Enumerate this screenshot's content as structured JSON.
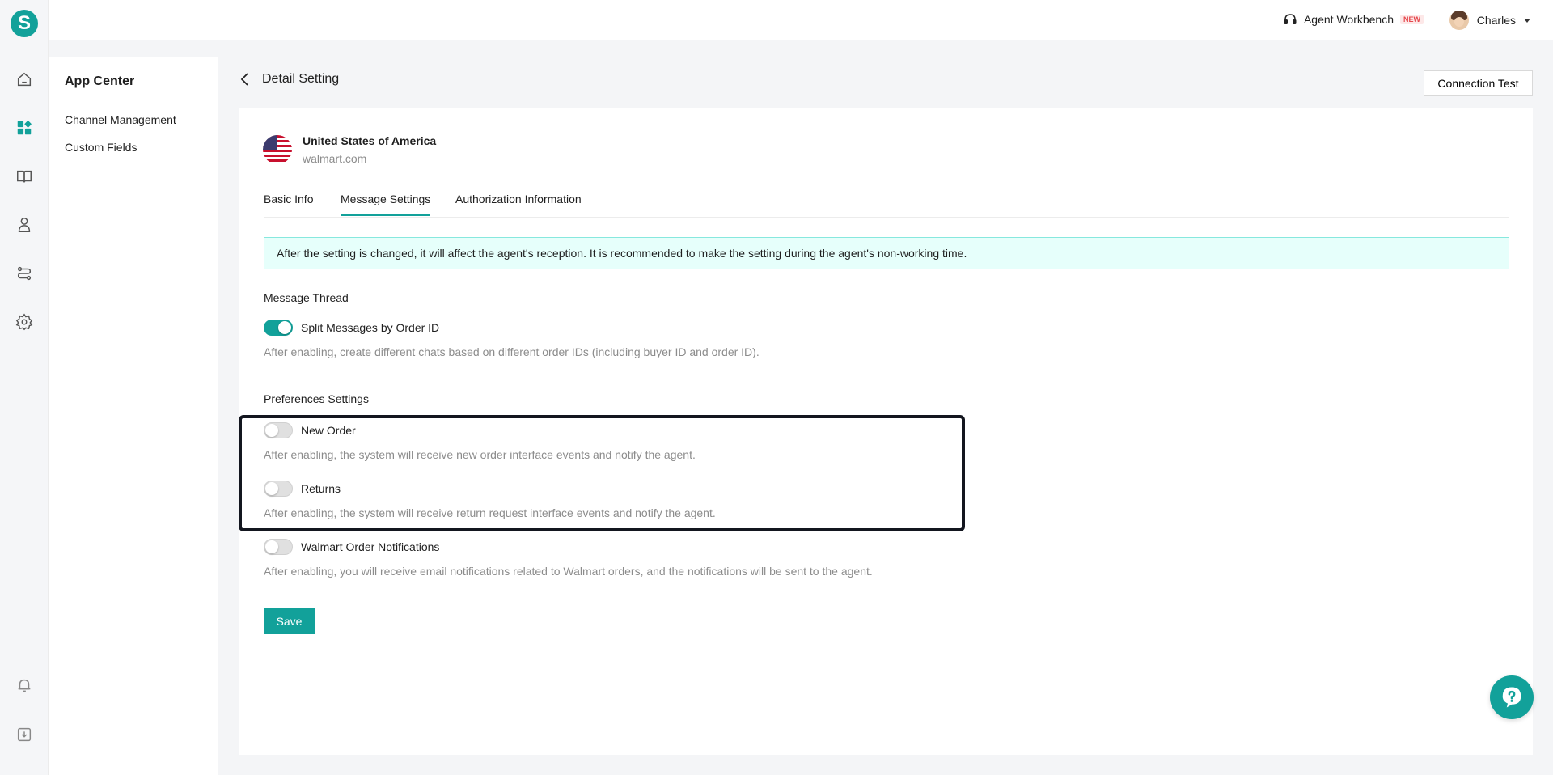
{
  "app": {
    "logo_letter": "S",
    "brand_color": "#12a19a"
  },
  "rail": {
    "items": [
      "home-icon",
      "apps-icon",
      "book-icon",
      "user-icon",
      "route-icon",
      "settings-icon"
    ],
    "bottom": [
      "bell-icon",
      "download-icon"
    ]
  },
  "topbar": {
    "workbench_label": "Agent Workbench",
    "workbench_badge": "NEW",
    "user_name": "Charles"
  },
  "subnav": {
    "title": "App Center",
    "items": [
      {
        "label": "Channel Management"
      },
      {
        "label": "Custom Fields"
      }
    ]
  },
  "header": {
    "title": "Detail Setting",
    "connection_test_label": "Connection Test"
  },
  "store": {
    "country": "United States of America",
    "domain": "walmart.com"
  },
  "tabs": [
    {
      "label": "Basic Info",
      "active": false
    },
    {
      "label": "Message Settings",
      "active": true
    },
    {
      "label": "Authorization Information",
      "active": false
    }
  ],
  "notice": "After the setting is changed, it will affect the agent's reception. It is recommended to make the setting during the agent's non-working time.",
  "message_thread": {
    "title": "Message Thread",
    "split": {
      "label": "Split Messages by Order ID",
      "enabled": true,
      "desc": "After enabling, create different chats based on different order IDs (including buyer ID and order ID)."
    }
  },
  "preferences": {
    "title": "Preferences Settings",
    "items": [
      {
        "label": "New Order",
        "enabled": false,
        "desc": "After enabling, the system will receive new order interface events and notify the agent."
      },
      {
        "label": "Returns",
        "enabled": false,
        "desc": "After enabling, the system will receive return request interface events and notify the agent."
      },
      {
        "label": "Walmart Order Notifications",
        "enabled": false,
        "desc": "After enabling, you will receive email notifications related to Walmart orders, and the notifications will be sent to the agent."
      }
    ]
  },
  "actions": {
    "save_label": "Save"
  }
}
